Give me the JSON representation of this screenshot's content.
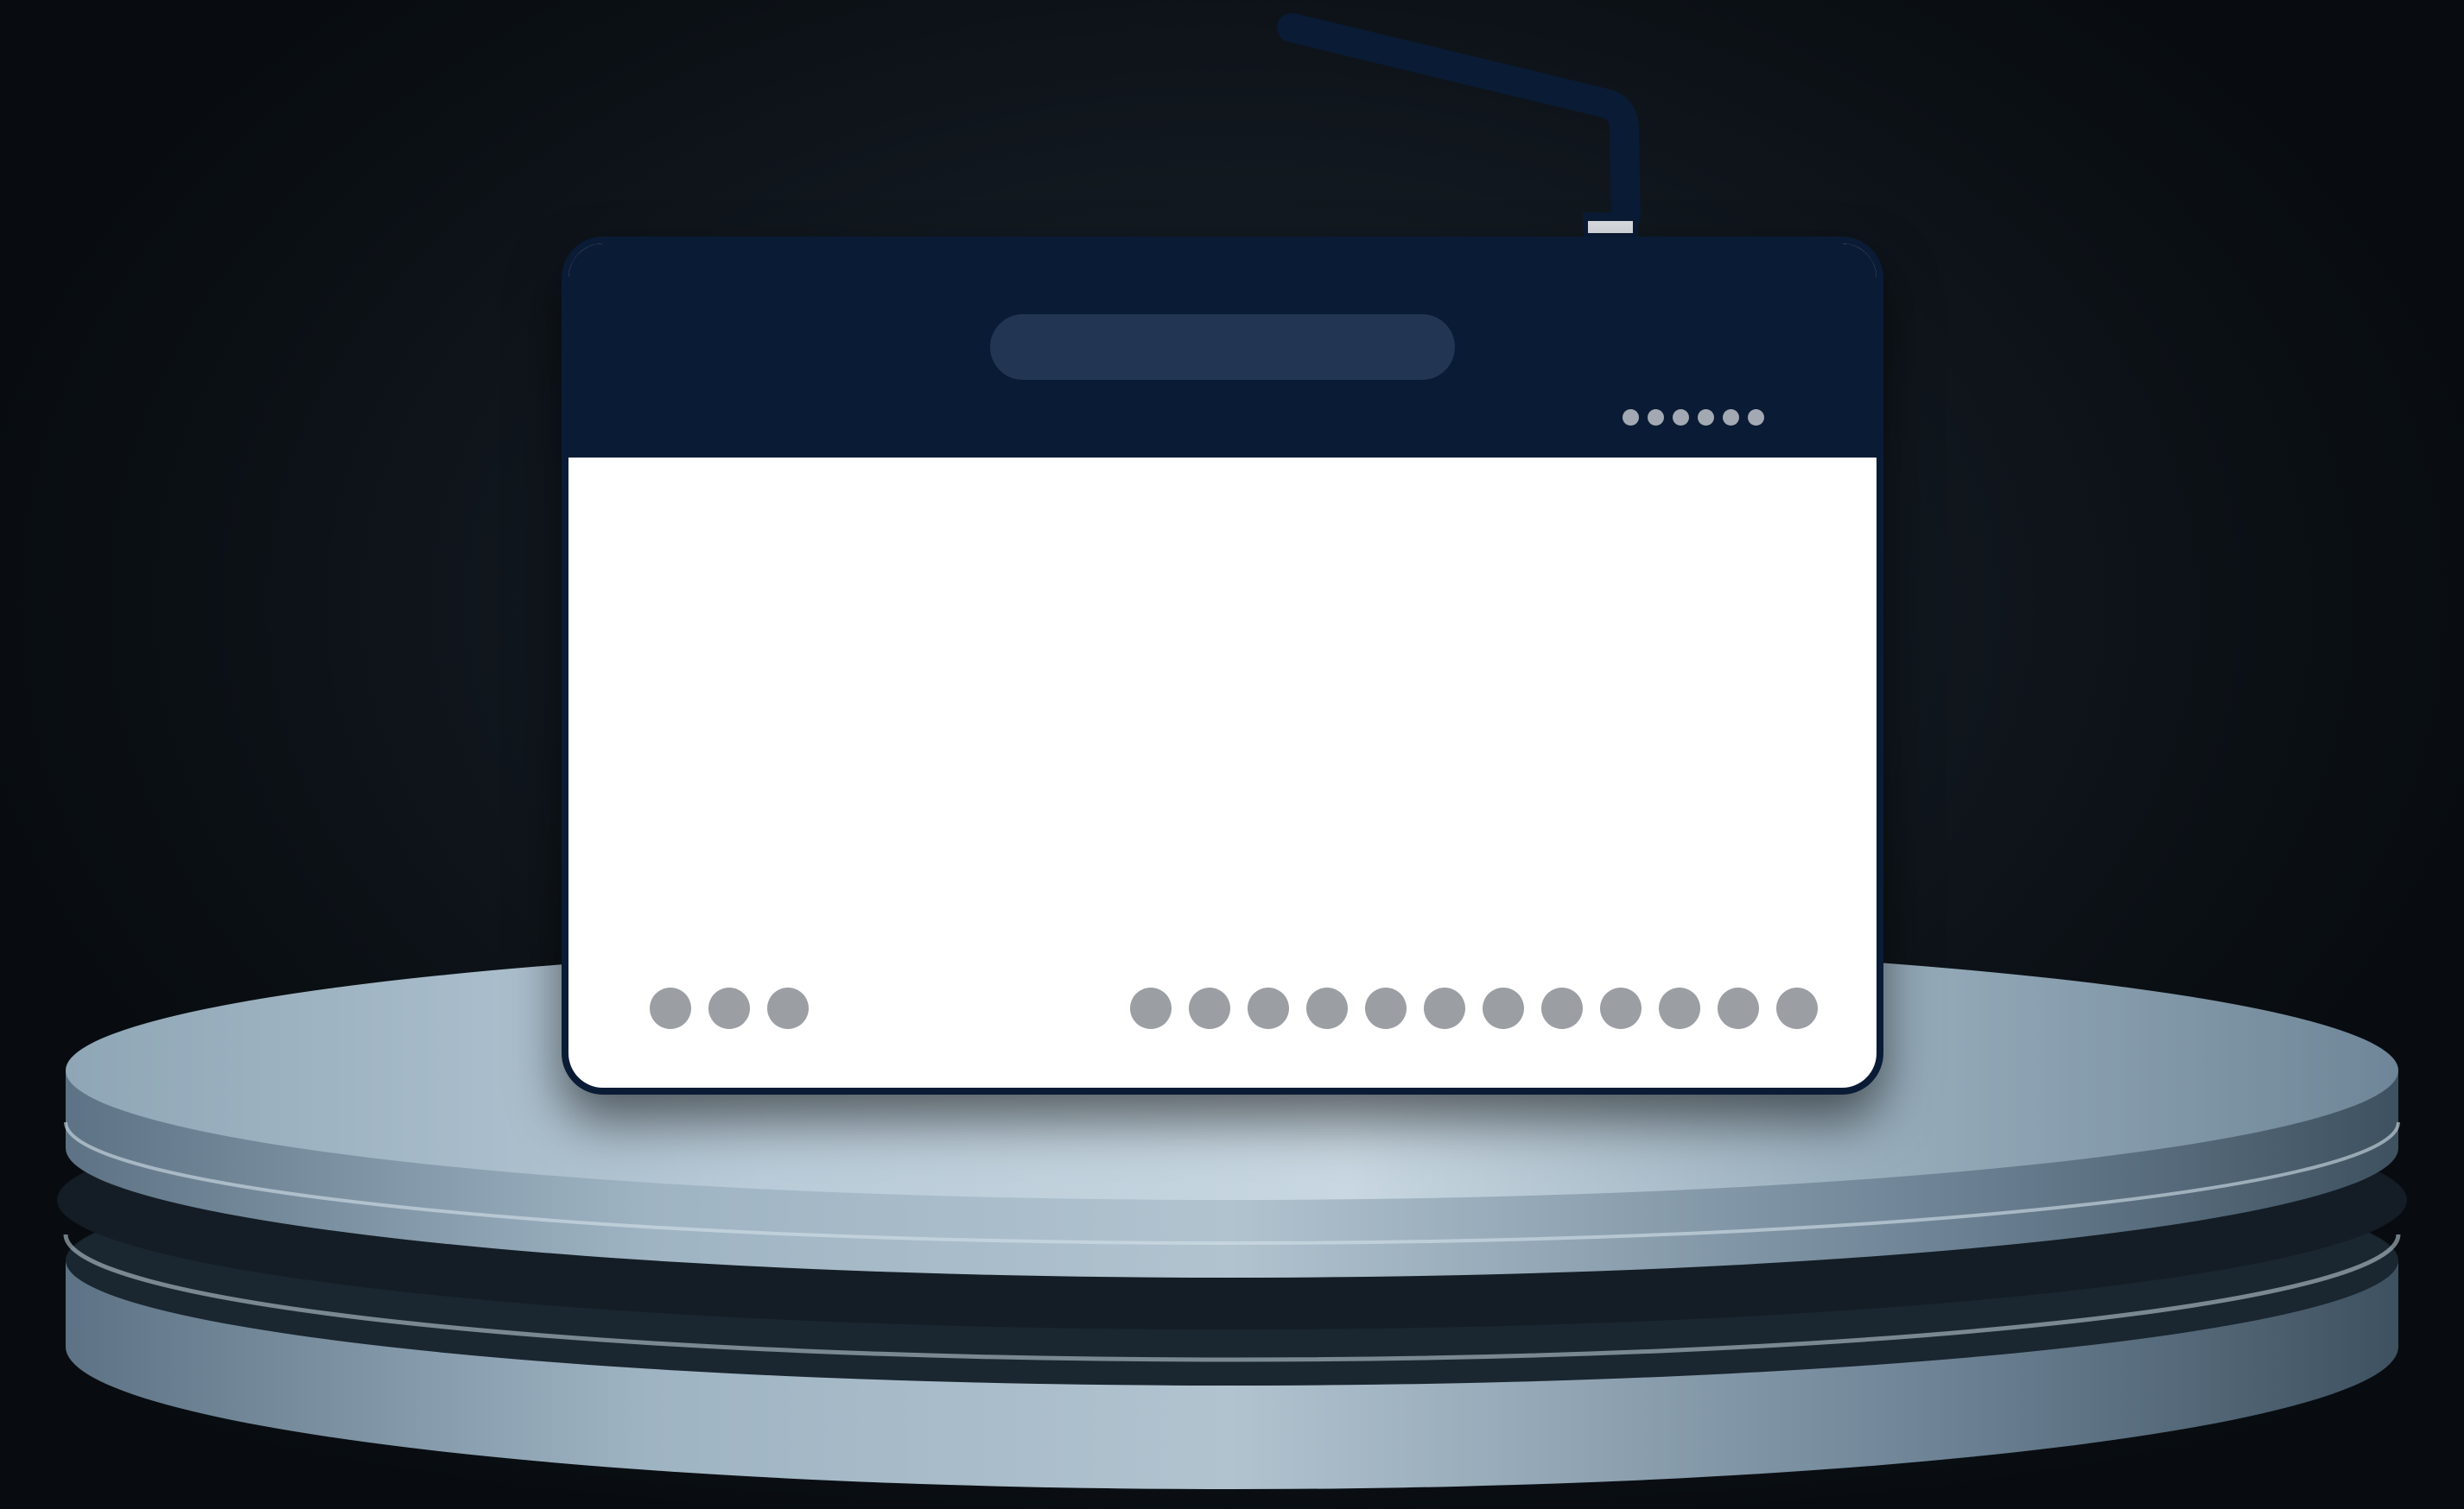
{
  "scene": {
    "subject": "router-illustration",
    "background_color": "#0c1116",
    "router_body_color": "#0a1b35",
    "router_face_color": "#ffffff",
    "title_pill_color": "#223654",
    "indicator_dot_color": "#a3a9b2",
    "port_color": "#9b9ea2",
    "pedestal_color": "#b7c9d6"
  },
  "router": {
    "indicator_lights": 6,
    "left_ports": 3,
    "right_ports": 12,
    "antenna": {
      "icon": "antenna-icon",
      "tip_color": "#d9dde2"
    }
  }
}
